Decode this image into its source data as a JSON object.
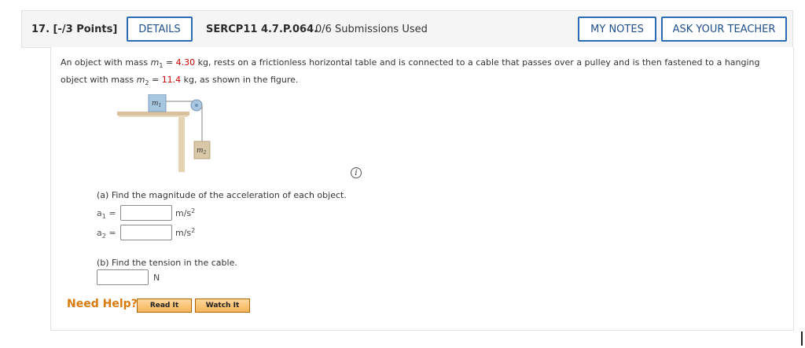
{
  "header": {
    "question_number": "17. [-/3 Points]",
    "details_label": "DETAILS",
    "code": "SERCP11 4.7.P.064.",
    "submissions": "0/6 Submissions Used",
    "my_notes_label": "MY NOTES",
    "ask_teacher_label": "ASK YOUR TEACHER"
  },
  "problem": {
    "text_part1": "An object with mass ",
    "m1_symbol": "m",
    "m1_sub": "1",
    "equals1": " = ",
    "m1_value": "4.30",
    "text_part2": " kg, rests on a frictionless horizontal table and is connected to a cable that passes over a pulley and is then fastened to a hanging object with mass ",
    "m2_symbol": "m",
    "m2_sub": "2",
    "equals2": " = ",
    "m2_value": "11.4",
    "text_part3": " kg, as shown in the figure."
  },
  "figure": {
    "m1_label": "m",
    "m1_sub": "1",
    "m2_label": "m",
    "m2_sub": "2"
  },
  "info_icon": "i",
  "part_a": {
    "prompt": "(a) Find the magnitude of the acceleration of each object.",
    "a1_symbol": "a",
    "a1_sub": "1",
    "a1_eq": " =",
    "a1_value": "",
    "a1_unit": "m/s",
    "a1_unit_sup": "2",
    "a2_symbol": "a",
    "a2_sub": "2",
    "a2_eq": " =",
    "a2_value": "",
    "a2_unit": "m/s",
    "a2_unit_sup": "2"
  },
  "part_b": {
    "prompt": "(b) Find the tension in the cable.",
    "value": "",
    "unit": "N"
  },
  "help": {
    "label": "Need Help?",
    "read_it": "Read It",
    "watch_it": "Watch It"
  },
  "colors": {
    "accent_blue": "#2a6bb4",
    "value_red": "#cc0000",
    "help_orange": "#d97a0b"
  }
}
